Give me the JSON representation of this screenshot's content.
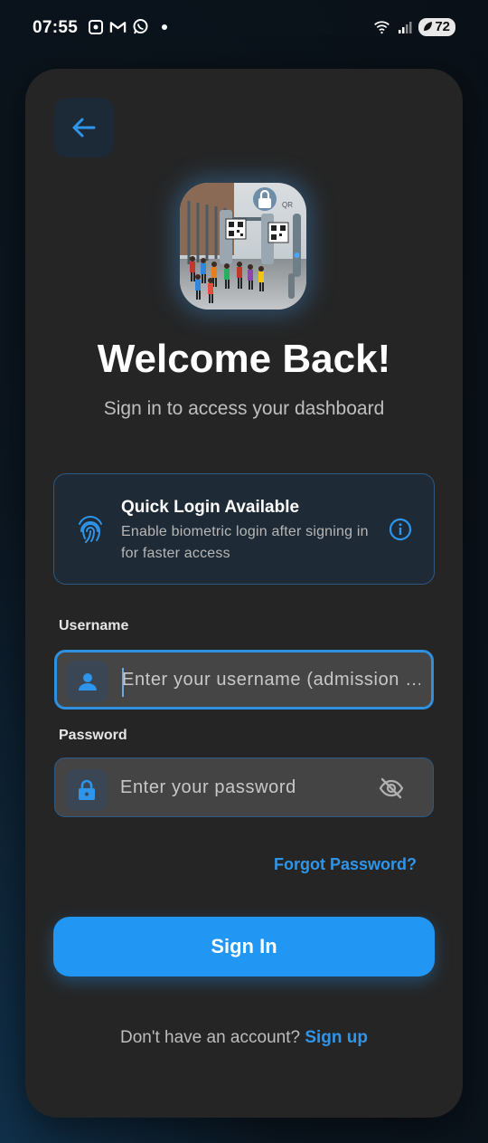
{
  "status_bar": {
    "time": "07:55",
    "battery": "72",
    "icons": [
      "screenshot-icon",
      "gmail-icon",
      "whatsapp-icon",
      "notification-dot",
      "wifi-icon",
      "signal-icon",
      "battery-icon"
    ]
  },
  "header": {
    "back_icon": "arrow-left-icon",
    "title": "Welcome Back!",
    "subtitle": "Sign in to access your dashboard"
  },
  "quick_login": {
    "title": "Quick Login Available",
    "description": "Enable biometric login after signing in for faster access",
    "icon": "fingerprint-icon",
    "info_icon": "info-icon"
  },
  "form": {
    "username_label": "Username",
    "username_placeholder": "Enter your username (admission …",
    "password_label": "Password",
    "password_placeholder": "Enter your password",
    "forgot_label": "Forgot Password?",
    "signin_label": "Sign In"
  },
  "footer": {
    "prompt": "Don't have an account?",
    "signup_label": "Sign up"
  },
  "colors": {
    "accent": "#2196f3",
    "card": "#252525",
    "field": "#444444",
    "link": "#2f95ea"
  }
}
